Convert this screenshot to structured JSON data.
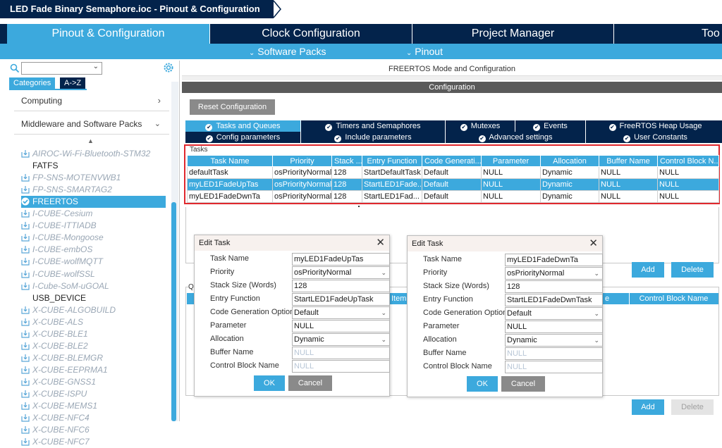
{
  "window": {
    "title": "LED Fade Binary Semaphore.ioc - Pinout & Configuration"
  },
  "tabs": [
    {
      "label": "Pinout & Configuration"
    },
    {
      "label": "Clock Configuration"
    },
    {
      "label": "Project Manager"
    },
    {
      "label": "Too"
    }
  ],
  "subnav": {
    "software_packs": "Software Packs",
    "pinout": "Pinout"
  },
  "sidebar": {
    "category_tabs": [
      "Categories",
      "A->Z"
    ],
    "sections": [
      "Computing",
      "Middleware and Software Packs"
    ],
    "packs": [
      "AIROC-Wi-Fi-Bluetooth-STM32",
      "FATFS",
      "FP-SNS-MOTENVWB1",
      "FP-SNS-SMARTAG2",
      "FREERTOS",
      "I-CUBE-Cesium",
      "I-CUBE-ITTIADB",
      "I-CUBE-Mongoose",
      "I-CUBE-embOS",
      "I-CUBE-wolfMQTT",
      "I-CUBE-wolfSSL",
      "I-Cube-SoM-uGOAL",
      "USB_DEVICE",
      "X-CUBE-ALGOBUILD",
      "X-CUBE-ALS",
      "X-CUBE-BLE1",
      "X-CUBE-BLE2",
      "X-CUBE-BLEMGR",
      "X-CUBE-EEPRMA1",
      "X-CUBE-GNSS1",
      "X-CUBE-ISPU",
      "X-CUBE-MEMS1",
      "X-CUBE-NFC4",
      "X-CUBE-NFC6",
      "X-CUBE-NFC7"
    ]
  },
  "main": {
    "mode_title": "FREERTOS Mode and Configuration",
    "config_title": "Configuration",
    "reset_button": "Reset Configuration",
    "config_tabs_row1": [
      "Tasks and Queues",
      "Timers and Semaphores",
      "Mutexes",
      "Events",
      "FreeRTOS Heap Usage"
    ],
    "config_tabs_row2": [
      "Config parameters",
      "Include parameters",
      "Advanced settings",
      "User Constants"
    ],
    "tasks_label": "Tasks",
    "tasks_columns": [
      "Task Name",
      "Priority",
      "Stack ...",
      "Entry Function",
      "Code Generati...",
      "Parameter",
      "Allocation",
      "Buffer Name",
      "Control Block N..."
    ],
    "tasks_rows": [
      [
        "defaultTask",
        "osPriorityNormal",
        "128",
        "StartDefaultTask",
        "Default",
        "NULL",
        "Dynamic",
        "NULL",
        "NULL"
      ],
      [
        "myLED1FadeUpTas",
        "osPriorityNormal",
        "128",
        "StartLED1Fade...",
        "Default",
        "NULL",
        "Dynamic",
        "NULL",
        "NULL"
      ],
      [
        "myLED1FadeDwnTa",
        "osPriorityNormal",
        "128",
        "StartLED1Fad...",
        "Default",
        "NULL",
        "Dynamic",
        "NULL",
        "NULL"
      ]
    ],
    "add_button": "Add",
    "delete_button": "Delete",
    "queues_label": "Q",
    "queues_columns_visible": [
      "Item",
      "e",
      "Control Block Name"
    ]
  },
  "dialogs": [
    {
      "title": "Edit Task",
      "fields": [
        {
          "label": "Task Name",
          "value": "myLED1FadeUpTas",
          "dropdown": false,
          "placeholder": false
        },
        {
          "label": "Priority",
          "value": "osPriorityNormal",
          "dropdown": true,
          "placeholder": false
        },
        {
          "label": "Stack Size (Words)",
          "value": "128",
          "dropdown": false,
          "placeholder": false
        },
        {
          "label": "Entry Function",
          "value": "StartLED1FadeUpTask",
          "dropdown": false,
          "placeholder": false
        },
        {
          "label": "Code Generation Option",
          "value": "Default",
          "dropdown": true,
          "placeholder": false
        },
        {
          "label": "Parameter",
          "value": "NULL",
          "dropdown": false,
          "placeholder": false
        },
        {
          "label": "Allocation",
          "value": "Dynamic",
          "dropdown": true,
          "placeholder": false
        },
        {
          "label": "Buffer Name",
          "value": "NULL",
          "dropdown": false,
          "placeholder": true
        },
        {
          "label": "Control Block Name",
          "value": "NULL",
          "dropdown": false,
          "placeholder": true
        }
      ],
      "ok": "OK",
      "cancel": "Cancel"
    },
    {
      "title": "Edit Task",
      "fields": [
        {
          "label": "Task Name",
          "value": "myLED1FadeDwnTa",
          "dropdown": false,
          "placeholder": false
        },
        {
          "label": "Priority",
          "value": "osPriorityNormal",
          "dropdown": true,
          "placeholder": false
        },
        {
          "label": "Stack Size (Words)",
          "value": "128",
          "dropdown": false,
          "placeholder": false
        },
        {
          "label": "Entry Function",
          "value": "StartLED1FadeDwnTask",
          "dropdown": false,
          "placeholder": false
        },
        {
          "label": "Code Generation Option",
          "value": "Default",
          "dropdown": true,
          "placeholder": false
        },
        {
          "label": "Parameter",
          "value": "NULL",
          "dropdown": false,
          "placeholder": false
        },
        {
          "label": "Allocation",
          "value": "Dynamic",
          "dropdown": true,
          "placeholder": false
        },
        {
          "label": "Buffer Name",
          "value": "NULL",
          "dropdown": false,
          "placeholder": true
        },
        {
          "label": "Control Block Name",
          "value": "NULL",
          "dropdown": false,
          "placeholder": true
        }
      ],
      "ok": "OK",
      "cancel": "Cancel"
    }
  ],
  "colors": {
    "navy": "#03234b",
    "accent": "#3ca9dd",
    "highlight_border": "#e0282e",
    "button_gray": "#8a8a8a"
  }
}
